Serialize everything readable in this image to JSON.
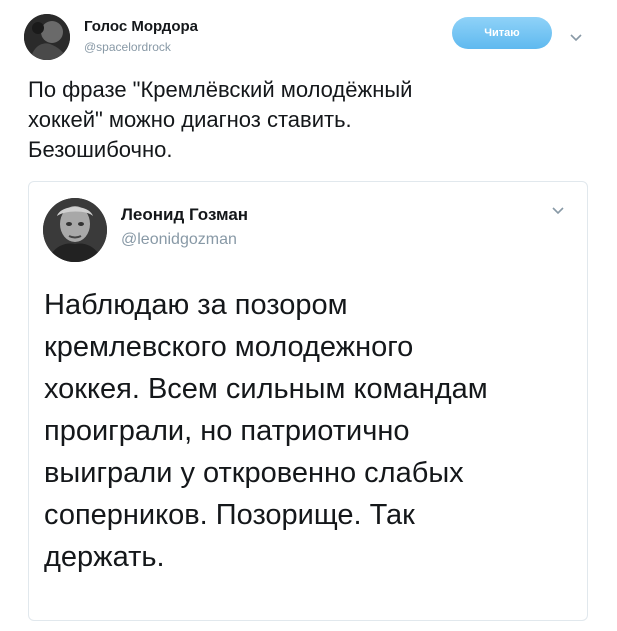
{
  "tweet": {
    "author_name": "Голос Мордора",
    "author_handle": "@spacelordrock",
    "follow_label": "Читаю",
    "text": "По фразе \"Кремлёвский молодёжный\nхоккей\" можно диагноз ставить.\nБезошибочно."
  },
  "quoted": {
    "author_name": "Леонид Гозман",
    "author_handle": "@leonidgozman",
    "text": "Наблюдаю за позором\nкремлевского молодежного\nхоккея. Всем сильным командам\nпроиграли, но патриотично\nвыиграли у откровенно слабых\nсоперников. Позорище. Так\nдержать."
  },
  "icons": {
    "more_options": "chevron-down-icon",
    "main_avatar": "avatar",
    "quote_avatar": "avatar"
  },
  "colors": {
    "follow_button": "#5fb9ef",
    "handle": "#8899a6",
    "text": "#14171a",
    "card_border": "#e1e8ed"
  }
}
